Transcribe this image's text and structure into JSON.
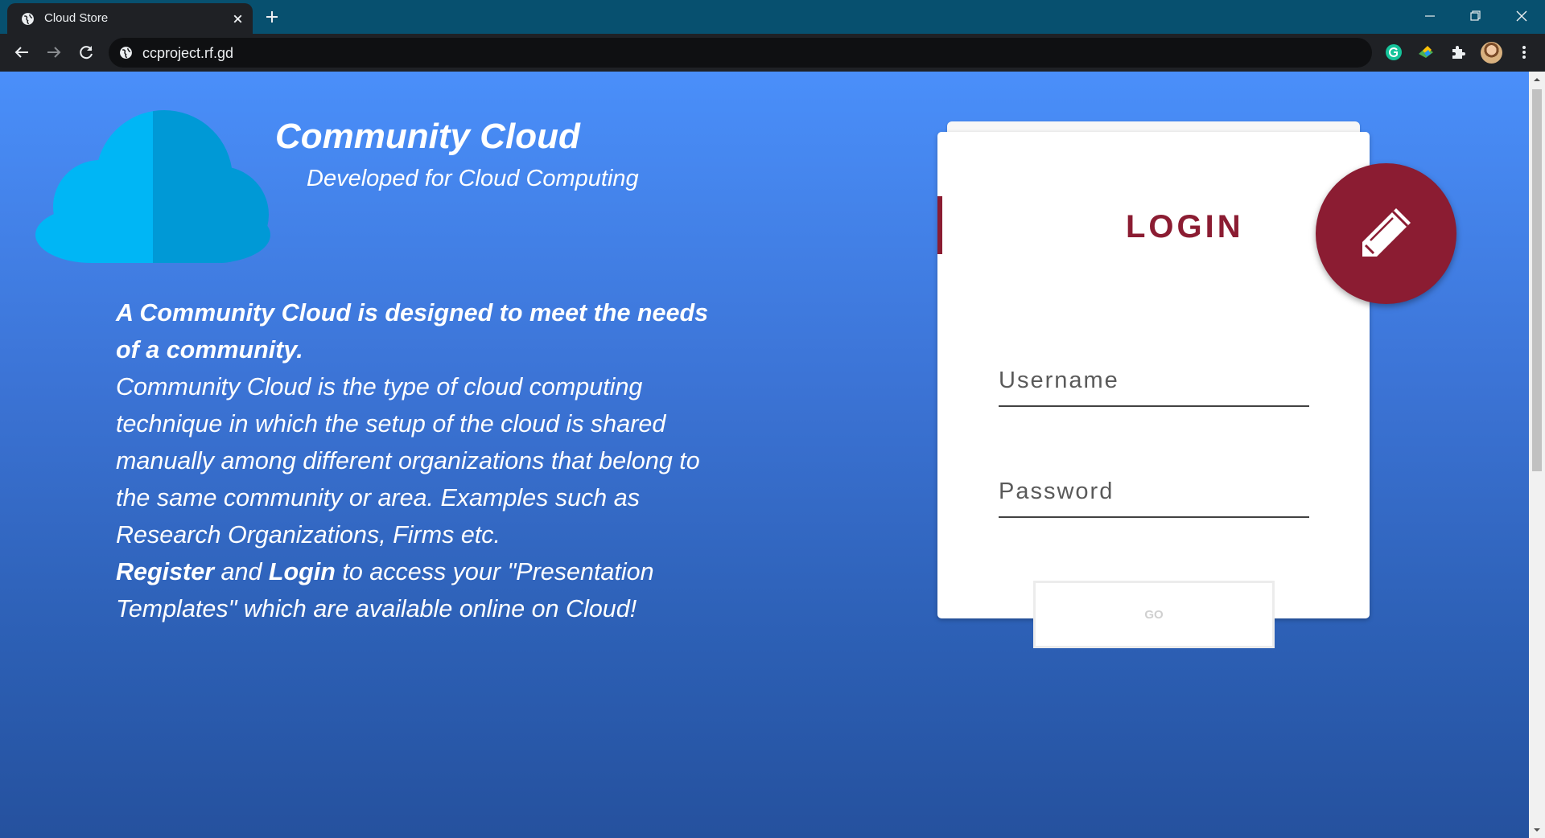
{
  "browser": {
    "tab_title": "Cloud Store",
    "url": "ccproject.rf.gd",
    "icons": [
      "globe-icon",
      "close-icon",
      "plus-icon",
      "minimize-icon",
      "restore-icon",
      "window-close-icon",
      "back-icon",
      "forward-icon",
      "reload-icon",
      "site-info-icon",
      "grammarly-icon",
      "extension-icon",
      "puzzle-icon",
      "avatar",
      "more-icon"
    ]
  },
  "hero": {
    "title": "Community Cloud",
    "subtitle": "Developed for Cloud Computing"
  },
  "intro": {
    "bold_line": "A Community Cloud is designed to meet the needs of a community.",
    "body": "Community Cloud is the type of cloud computing technique in which the setup of the cloud is shared manually among different organizations that belong to the same community or area. Examples such as Research Organizations, Firms etc.",
    "register": "Register",
    "and": " and ",
    "login": "Login",
    "cta_rest": " to access your \"Presentation Templates\" which are available online on Cloud!"
  },
  "login_form": {
    "title": "LOGIN",
    "username_placeholder": "Username",
    "username_value": "",
    "password_placeholder": "Password",
    "password_value": "",
    "submit_label": "GO",
    "fab_icon": "pencil-icon"
  },
  "colors": {
    "accent": "#8b1c32",
    "chrome_tabbar": "#07506f",
    "cloud_light": "#00b6f5",
    "cloud_dark": "#0099d6"
  }
}
